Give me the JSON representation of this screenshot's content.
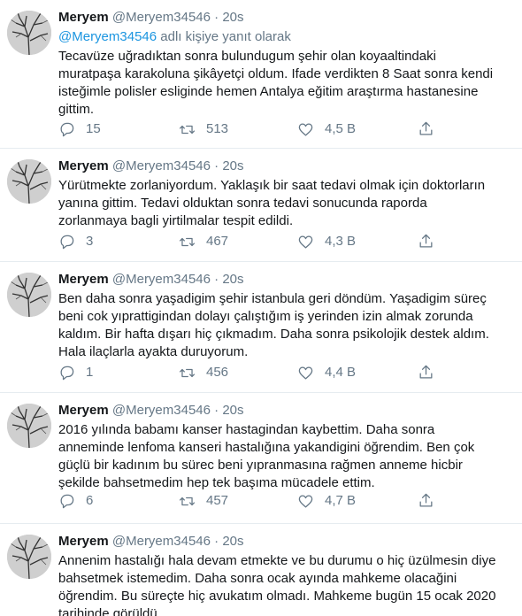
{
  "tweets": [
    {
      "name": "Meryem",
      "handle": "@Meryem34546",
      "dot": "·",
      "time": "20s",
      "reply_mention": "@Meryem34546",
      "reply_suffix": " adlı kişiye yanıt olarak",
      "lines": [
        "Tecavüze uğradıktan sonra bulundugum şehir olan koyaaltindaki",
        "muratpaşa karakoluna şikâyetçi oldum. Ifade verdikten 8 Saat sonra kendi",
        "isteğimle polisler esliginde hemen Antalya eğitim araştırma hastanesine",
        "gittim."
      ],
      "replies": "15",
      "retweets": "513",
      "likes": "4,5 B"
    },
    {
      "name": "Meryem",
      "handle": "@Meryem34546",
      "dot": "·",
      "time": "20s",
      "lines": [
        "Yürütmekte zorlaniyordum. Yaklaşık  bir saat tedavi olmak için doktorların",
        "yanına gittim. Tedavi olduktan sonra tedavi sonucunda raporda",
        "zorlanmaya bagli yirtilmalar  tespit edildi."
      ],
      "replies": "3",
      "retweets": "467",
      "likes": "4,3 B"
    },
    {
      "name": "Meryem",
      "handle": "@Meryem34546",
      "dot": "·",
      "time": "20s",
      "lines": [
        "Ben daha sonra yaşadigim şehir istanbula geri döndüm. Yaşadigim süreç",
        "beni cok yıprattigindan dolayı çalıştığım iş yerinden izin almak  zorunda",
        "kaldım. Bir hafta dışarı hiç çıkmadım. Daha sonra psikolojik destek aldım.",
        "Hala ilaçlarla ayakta duruyorum."
      ],
      "replies": "1",
      "retweets": "456",
      "likes": "4,4 B"
    },
    {
      "name": "Meryem",
      "handle": "@Meryem34546",
      "dot": "·",
      "time": "20s",
      "lines": [
        "2016 yılında babamı kanser hastagindan kaybettim. Daha sonra",
        "anneminde lenfoma kanseri hastalığına yakandigini öğrendim. Ben çok",
        "güçlü bir kadınım bu sürec beni yıpranmasına rağmen anneme hicbir",
        "şekilde bahsetmedim hep tek başıma mücadele ettim."
      ],
      "replies": "6",
      "retweets": "457",
      "likes": "4,7 B"
    },
    {
      "name": "Meryem",
      "handle": "@Meryem34546",
      "dot": "·",
      "time": "20s",
      "lines": [
        "Annenim hastalığı hala devam etmekte ve bu durumu o hiç üzülmesin diye",
        "bahsetmek istemedim. Daha sonra ocak ayında mahkeme olacağini",
        "öğrendim. Bu süreçte hiç avukatım olmadı. Mahkeme bugün 15 ocak 2020",
        "tarihinde görüldü."
      ]
    }
  ],
  "icons": {
    "reply": "reply-icon",
    "retweet": "retweet-icon",
    "like": "heart-icon",
    "share": "share-icon",
    "avatar": "tree-branches-avatar"
  },
  "colors": {
    "text": "#14171a",
    "secondary": "#657786",
    "link": "#1b95e0",
    "divider": "#e6ecf0"
  }
}
